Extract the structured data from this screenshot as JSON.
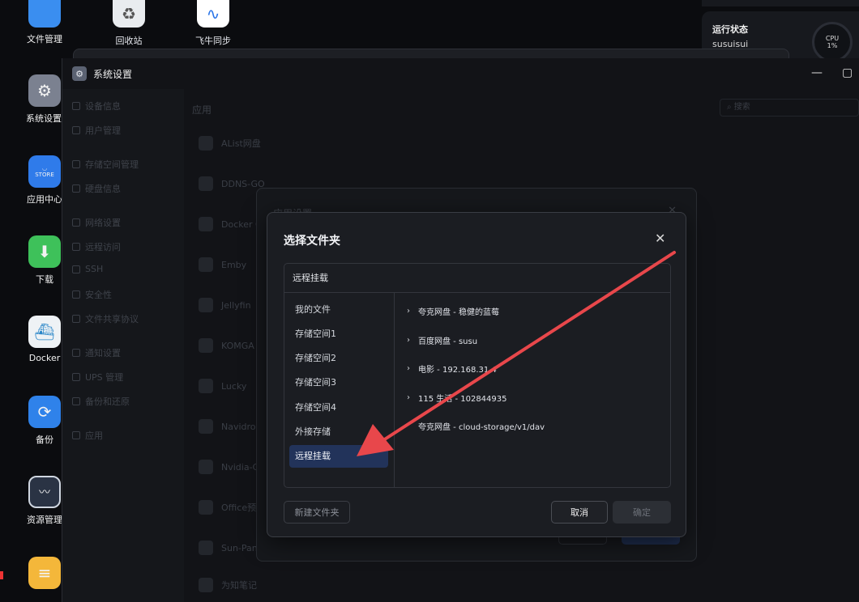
{
  "desktop": {
    "top_items": [
      {
        "label": "文件管理",
        "icon": "folder-icon"
      },
      {
        "label": "回收站",
        "icon": "recycle-bin-icon"
      },
      {
        "label": "飞牛同步",
        "icon": "sync-icon"
      }
    ],
    "items": [
      {
        "label": "系统设置",
        "icon": "gear-icon"
      },
      {
        "label": "应用中心",
        "icon": "store-icon",
        "badge": "STORE"
      },
      {
        "label": "下载",
        "icon": "download-icon"
      },
      {
        "label": "Docker",
        "icon": "docker-icon"
      },
      {
        "label": "备份",
        "icon": "backup-icon"
      },
      {
        "label": "资源管理",
        "icon": "resource-monitor-icon"
      }
    ]
  },
  "status_widget": {
    "title": "运行状态",
    "user": "susuisui",
    "cpu_label": "CPU",
    "cpu_value": "1%"
  },
  "settings_window": {
    "title": "系统设置",
    "sidebar": [
      {
        "label": "设备信息"
      },
      {
        "label": "用户管理"
      },
      {
        "label": "存储空间管理"
      },
      {
        "label": "硬盘信息"
      },
      {
        "label": "网络设置"
      },
      {
        "label": "远程访问"
      },
      {
        "label": "SSH"
      },
      {
        "label": "安全性"
      },
      {
        "label": "文件共享协议"
      },
      {
        "label": "通知设置"
      },
      {
        "label": "UPS 管理"
      },
      {
        "label": "备份和还原"
      },
      {
        "label": "应用"
      }
    ],
    "main_heading": "应用",
    "search_placeholder": "搜索",
    "apps": [
      "AList网盘",
      "DDNS-GO",
      "Docker C",
      "Emby",
      "Jellyfin",
      "KOMGA",
      "Lucky",
      "Navidro",
      "Nvidia-C",
      "Office预",
      "Sun-Pan",
      "为知笔记"
    ]
  },
  "app_settings_dialog": {
    "title": "应用设置"
  },
  "folder_dialog": {
    "title": "选择文件夹",
    "section_label": "远程挂载",
    "tree": [
      "我的文件",
      "存储空间1",
      "存储空间2",
      "存储空间3",
      "存储空间4",
      "外接存储",
      "远程挂载"
    ],
    "selected_index": 6,
    "entries": [
      {
        "label": "夸克网盘 - 稳健的蓝莓",
        "expandable": true
      },
      {
        "label": "百度网盘 - susu",
        "expandable": true
      },
      {
        "label": "电影 - 192.168.31.4",
        "expandable": true
      },
      {
        "label": "115 生活 - 102844935",
        "expandable": true
      },
      {
        "label": "夸克网盘 - cloud-storage/v1/dav",
        "expandable": false
      }
    ],
    "buttons": {
      "new_folder": "新建文件夹",
      "cancel": "取消",
      "confirm": "确定"
    }
  },
  "colors": {
    "arrow": "#e8474b",
    "selected": "#22335a",
    "accent": "#2f6fe4"
  }
}
